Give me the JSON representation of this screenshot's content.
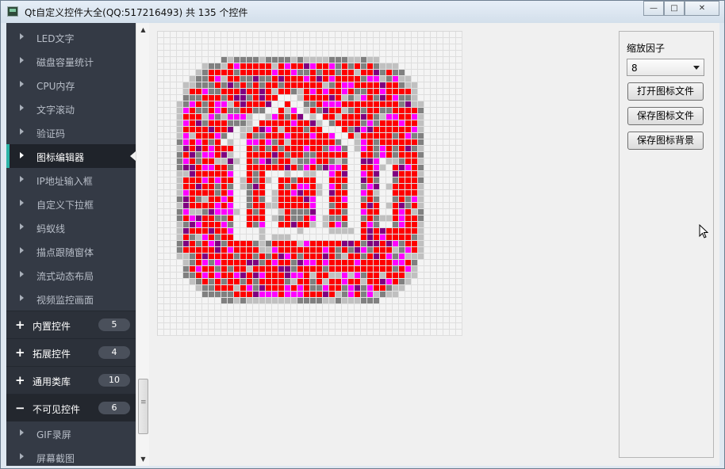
{
  "window": {
    "title": "Qt自定义控件大全(QQ:517216493) 共 135 个控件",
    "controls": {
      "minimize": "—",
      "maximize": "□",
      "close": "✕"
    }
  },
  "sidebar": {
    "items": [
      {
        "label": "LED文字",
        "active": false
      },
      {
        "label": "磁盘容量统计",
        "active": false
      },
      {
        "label": "CPU内存",
        "active": false
      },
      {
        "label": "文字滚动",
        "active": false
      },
      {
        "label": "验证码",
        "active": false
      },
      {
        "label": "图标编辑器",
        "active": true
      },
      {
        "label": "IP地址输入框",
        "active": false
      },
      {
        "label": "自定义下拉框",
        "active": false
      },
      {
        "label": "蚂蚁线",
        "active": false
      },
      {
        "label": "描点跟随窗体",
        "active": false
      },
      {
        "label": "流式动态布局",
        "active": false
      },
      {
        "label": "视频监控画面",
        "active": false
      }
    ],
    "groups": [
      {
        "sign": "+",
        "label": "内置控件",
        "count": "5"
      },
      {
        "sign": "+",
        "label": "拓展控件",
        "count": "4"
      },
      {
        "sign": "+",
        "label": "通用类库",
        "count": "10"
      },
      {
        "sign": "−",
        "label": "不可见控件",
        "count": "6"
      }
    ],
    "items_after": [
      {
        "label": "GIF录屏"
      },
      {
        "label": "屏幕截图"
      }
    ],
    "colors": {
      "background": "#343a45",
      "active": "#1f232a",
      "accent": "#2ab3a6"
    }
  },
  "editor": {
    "grid_size": 48,
    "colors": {
      "red": "#ff0000",
      "magenta": "#ff00ff",
      "purple": "#800080",
      "gray": "#808080",
      "light": "#c0c0c0",
      "empty": "#f4f4f4"
    }
  },
  "panel": {
    "scale_label": "缩放因子",
    "scale_value": "8",
    "buttons": {
      "open": "打开图标文件",
      "save": "保存图标文件",
      "save_bg": "保存图标背景"
    }
  }
}
